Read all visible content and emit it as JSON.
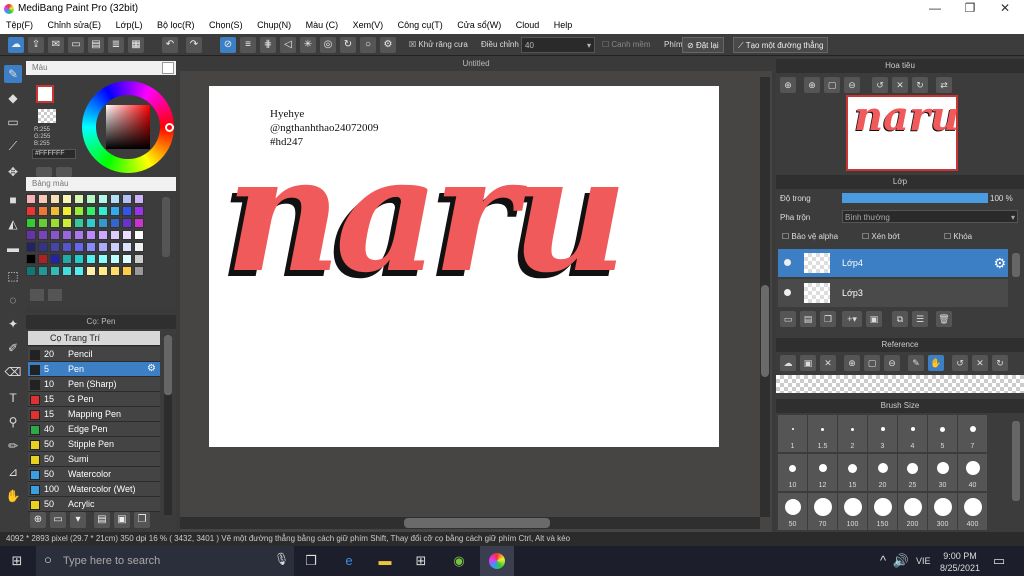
{
  "window": {
    "title": "MediBang Paint Pro (32bit)",
    "min": "—",
    "max": "❐",
    "close": "✕"
  },
  "menu": [
    "Tệp(F)",
    "Chỉnh sửa(E)",
    "Lớp(L)",
    "Bộ lọc(R)",
    "Chọn(S)",
    "Chụp(N)",
    "Màu (C)",
    "Xem(V)",
    "Công cụ(T)",
    "Cửa sổ(W)",
    "Cloud",
    "Help"
  ],
  "toolbar": {
    "antialias_label": "Khử răng cưa",
    "adjust_label": "Điều chỉnh",
    "adjust_value": "40",
    "snap_label": "Canh mềm",
    "key_label": "Phím",
    "reset_label": "Đặt lại",
    "ruler_label": "Tạo một đường thẳng"
  },
  "color_panel": {
    "title": "Màu",
    "rgb": [
      "R:255",
      "G:255",
      "B:255"
    ],
    "hex": "#FFFFFF",
    "palette_title": "Bảng màu",
    "accent": "#3d7fc4"
  },
  "brush_panel": {
    "title": "Cọ: Pen",
    "group": "Cọ Trang Trí",
    "items": [
      {
        "size": "20",
        "name": "Pencil",
        "color": "#222222"
      },
      {
        "size": "5",
        "name": "Pen",
        "color": "#222222",
        "selected": true
      },
      {
        "size": "10",
        "name": "Pen (Sharp)",
        "color": "#222222"
      },
      {
        "size": "15",
        "name": "G Pen",
        "color": "#e03030"
      },
      {
        "size": "15",
        "name": "Mapping Pen",
        "color": "#e03030"
      },
      {
        "size": "40",
        "name": "Edge Pen",
        "color": "#2fa84a"
      },
      {
        "size": "50",
        "name": "Stipple Pen",
        "color": "#e8d020"
      },
      {
        "size": "50",
        "name": "Sumi",
        "color": "#e8d020"
      },
      {
        "size": "50",
        "name": "Watercolor",
        "color": "#38a0e0"
      },
      {
        "size": "100",
        "name": "Watercolor (Wet)",
        "color": "#38a0e0"
      },
      {
        "size": "50",
        "name": "Acrylic",
        "color": "#e8d020"
      }
    ]
  },
  "canvas": {
    "tab_title": "Untitled",
    "text_lines": [
      "Hyehye",
      "@ngthanhthao24072009",
      "#hd247"
    ],
    "lettering": "naru",
    "lettering_color": "#f05a5a"
  },
  "navigator": {
    "title": "Hoa tiêu"
  },
  "layer_panel": {
    "title": "Lớp",
    "opacity_label": "Độ trong",
    "opacity_value": "100 %",
    "opacity_fraction": 1.0,
    "blend_label": "Pha trộn",
    "blend_value": "Bình thường",
    "protect_alpha": "Bảo vệ alpha",
    "clipping": "Xén bớt",
    "lock": "Khóa",
    "layers": [
      {
        "name": "Lớp4",
        "selected": true
      },
      {
        "name": "Lớp3",
        "selected": false
      }
    ]
  },
  "reference": {
    "title": "Reference"
  },
  "brush_size": {
    "title": "Brush Size",
    "sizes": [
      "1",
      "1.5",
      "2",
      "3",
      "4",
      "5",
      "7",
      "10",
      "12",
      "15",
      "20",
      "25",
      "30",
      "40",
      "50",
      "70",
      "100",
      "150",
      "200",
      "300",
      "400"
    ]
  },
  "status": {
    "text": "4092 * 2893 pixel   (29.7 * 21cm)   350 dpi   16 %   ( 3432, 3401 )   Vẽ một đường thẳng bằng cách giữ phím Shift, Thay đổi cỡ cọ bằng cách giữ phím Ctrl, Alt và kéo"
  },
  "taskbar": {
    "search_placeholder": "Type here to search",
    "lang": "VIE",
    "time": "9:00 PM",
    "date": "8/25/2021"
  }
}
